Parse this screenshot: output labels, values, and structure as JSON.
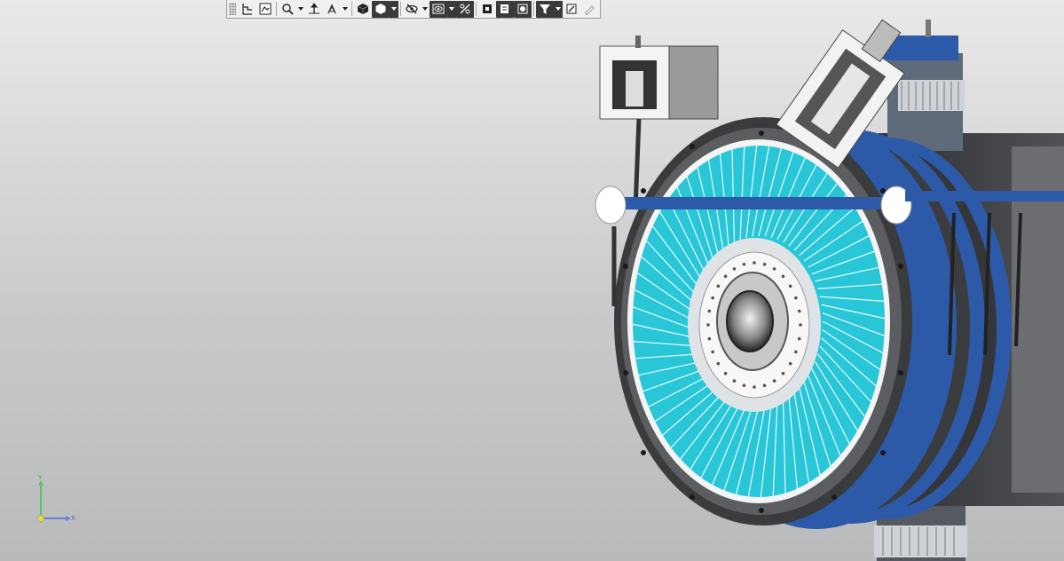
{
  "toolbar": {
    "buttons": [
      {
        "id": "tree-view",
        "icon": "tree-structure-icon",
        "has_dropdown": false
      },
      {
        "id": "properties",
        "icon": "properties-panel-icon",
        "has_dropdown": false
      },
      {
        "id": "zoom",
        "icon": "zoom-magnifier-icon",
        "has_dropdown": true
      },
      {
        "id": "pan",
        "icon": "pan-arrows-icon",
        "has_dropdown": false
      },
      {
        "id": "rotate",
        "icon": "rotate-axes-icon",
        "has_dropdown": true
      },
      {
        "id": "orientation",
        "icon": "view-orientation-cube-icon",
        "has_dropdown": false
      },
      {
        "id": "display-style",
        "icon": "shaded-hexagon-icon",
        "has_dropdown": true,
        "active": true
      },
      {
        "id": "hide-show",
        "icon": "hide-eye-icon",
        "has_dropdown": true
      },
      {
        "id": "visibility",
        "icon": "visibility-eye-icon",
        "has_dropdown": true,
        "active": true
      },
      {
        "id": "section",
        "icon": "section-cut-icon",
        "has_dropdown": false,
        "active": true
      },
      {
        "id": "cross-section",
        "icon": "cross-section-icon",
        "has_dropdown": false
      },
      {
        "id": "perspective",
        "icon": "perspective-view-icon",
        "has_dropdown": false,
        "active": true
      },
      {
        "id": "render-mode",
        "icon": "render-mode-icon",
        "has_dropdown": false,
        "active": true
      },
      {
        "id": "filter",
        "icon": "filter-funnel-icon",
        "has_dropdown": true,
        "active": true
      },
      {
        "id": "measure",
        "icon": "measure-icon",
        "has_dropdown": false
      },
      {
        "id": "edit",
        "icon": "pencil-icon",
        "has_dropdown": false,
        "disabled": true
      }
    ]
  },
  "triad": {
    "x_label": "X",
    "y_label": "Y",
    "x_color": "#6b7fd6",
    "y_color": "#5cc45c",
    "origin_color": "#e8e030"
  },
  "colors": {
    "accent_cyan": "#29c6d8",
    "housing_blue": "#2d5aa8",
    "dark_metal": "#3a3b3d"
  }
}
